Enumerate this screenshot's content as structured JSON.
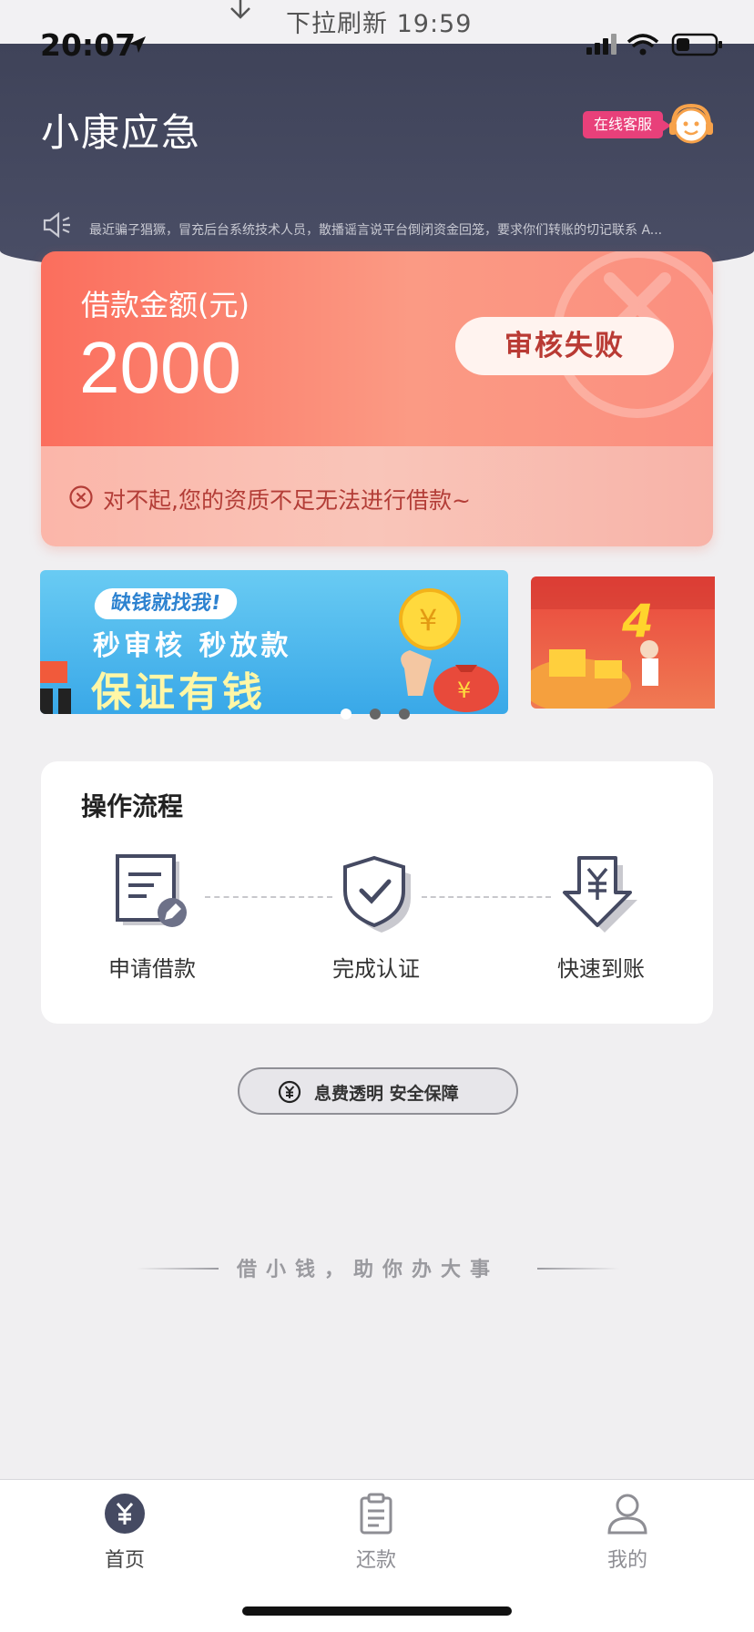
{
  "pull_refresh": {
    "text": "下拉刷新 19:59",
    "icon": "arrow-down-icon"
  },
  "status_bar": {
    "time": "20:07"
  },
  "header": {
    "title": "小康应急",
    "customer_service_badge": "在线客服",
    "notice": "最近骗子猖獗，冒充后台系统技术人员，散播谣言说平台倒闭资金回笼，要求你们转账的切记联系 A..."
  },
  "loan": {
    "label": "借款金额(元)",
    "amount": "2000",
    "status": "审核失败",
    "message": "对不起,您的资质不足无法进行借款~"
  },
  "banners": {
    "main": {
      "chip": "缺钱就找我!",
      "line1": "秒审核 秒放款",
      "line2": "保证有钱"
    },
    "second": {
      "text": "4"
    },
    "active_index": 0
  },
  "process": {
    "title": "操作流程",
    "steps": [
      {
        "label": "申请借款",
        "icon": "application-form-icon"
      },
      {
        "label": "完成认证",
        "icon": "shield-check-icon"
      },
      {
        "label": "快速到账",
        "icon": "yuan-arrow-down-icon"
      }
    ]
  },
  "safety": {
    "text": "息费透明 安全保障"
  },
  "slogan": "借小钱，助你办大事",
  "tabbar": {
    "items": [
      {
        "label": "首页",
        "icon": "yuan-circle-icon",
        "active": true
      },
      {
        "label": "还款",
        "icon": "clipboard-icon",
        "active": false
      },
      {
        "label": "我的",
        "icon": "user-icon",
        "active": false
      }
    ]
  },
  "colors": {
    "header": "#454a62",
    "accent": "#fb6e5d",
    "badge": "#e8407a"
  }
}
